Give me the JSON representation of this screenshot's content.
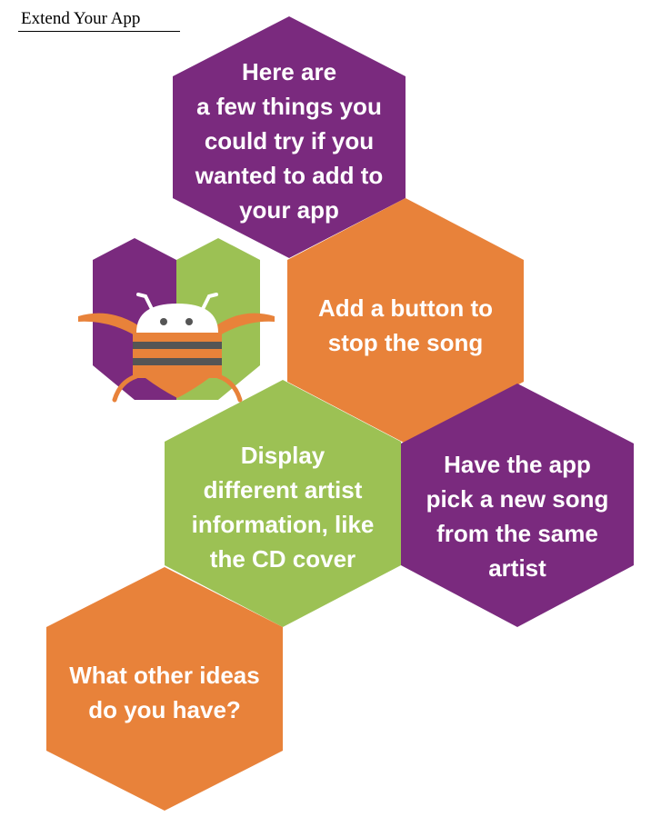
{
  "heading": "Extend Your App",
  "colors": {
    "purple": "#7a2a7e",
    "orange": "#e8823a",
    "green": "#9cc154",
    "bee_stripe": "#555555"
  },
  "hexagons": [
    {
      "name": "hex-intro",
      "color": "purple",
      "text": "Here are\na few things you\ncould try if you\nwanted to add to\nyour app"
    },
    {
      "name": "hex-stop-song",
      "color": "orange",
      "text": "Add a button to\nstop the song"
    },
    {
      "name": "hex-artist-info",
      "color": "green",
      "text": "Display\ndifferent artist\ninformation, like\nthe CD cover"
    },
    {
      "name": "hex-new-song",
      "color": "purple",
      "text": "Have the app\npick a new song\nfrom the same\nartist"
    },
    {
      "name": "hex-other-ideas",
      "color": "orange",
      "text": "What other ideas\ndo you have?"
    }
  ],
  "logo_icon": "app-inventor-bee-icon"
}
